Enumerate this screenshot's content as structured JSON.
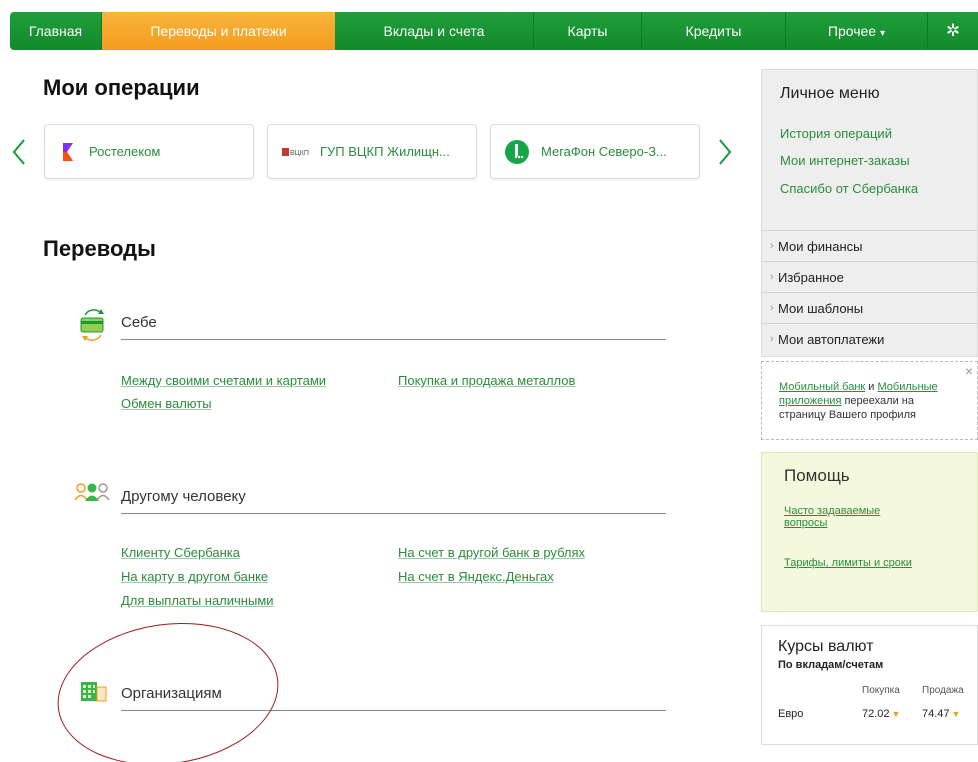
{
  "nav": {
    "items": [
      "Главная",
      "Переводы и платежи",
      "Вклады и счета",
      "Карты",
      "Кредиты",
      "Прочее"
    ],
    "active": "Переводы и платежи",
    "caret": "▾",
    "settings_icon": "gear-icon"
  },
  "my_operations": {
    "title": "Мои операции",
    "cards": [
      {
        "label": "Ростелеком",
        "icon": "rostelecom-logo-icon"
      },
      {
        "label": "ГУП ВЦКП Жилищн...",
        "icon": "vckp-logo-icon",
        "badge": "ВЦКП"
      },
      {
        "label": "МегаФон Северо-З...",
        "icon": "megafon-logo-icon"
      }
    ],
    "prev_arrow": "‹",
    "next_arrow": "›"
  },
  "transfers": {
    "title": "Переводы",
    "self": {
      "heading": "Себе",
      "links": [
        "Между своими счетами и картами",
        "Обмен валюты",
        "Покупка и продажа металлов"
      ]
    },
    "person": {
      "heading": "Другому человеку",
      "links": [
        "Клиенту Сбербанка",
        "На карту в другом банке",
        "Для выплаты наличными",
        "На счет в другой банк в рублях",
        "На счет в Яндекс.Деньгах"
      ]
    },
    "orgs": {
      "heading": "Организациям"
    }
  },
  "personal_menu": {
    "title": "Личное меню",
    "links": [
      "История операций",
      "Мои интернет-заказы",
      "Спасибо от Сбербанка"
    ],
    "sections": [
      "Мои финансы",
      "Избранное",
      "Мои шаблоны",
      "Мои автоплатежи"
    ]
  },
  "notice": {
    "link1": "Мобильный банк",
    "and": " и ",
    "link2": "Мобильные приложения",
    "rest": " переехали на страницу Вашего профиля",
    "close": "×"
  },
  "help": {
    "title": "Помощь",
    "links": [
      "Часто задаваемые вопросы",
      "Тарифы, лимиты и сроки"
    ]
  },
  "rates": {
    "title": "Курсы валют",
    "subtitle": "По вкладам/счетам",
    "columns": [
      "Покупка",
      "Продажа"
    ],
    "rows": [
      {
        "currency": "Евро",
        "buy": "72.02",
        "sell": "74.47"
      }
    ]
  },
  "colors": {
    "brand_green": "#1f9e3a",
    "active_orange": "#f8b53a",
    "link_green": "#2a8d3c",
    "annotation_red": "#9e1b1b"
  }
}
